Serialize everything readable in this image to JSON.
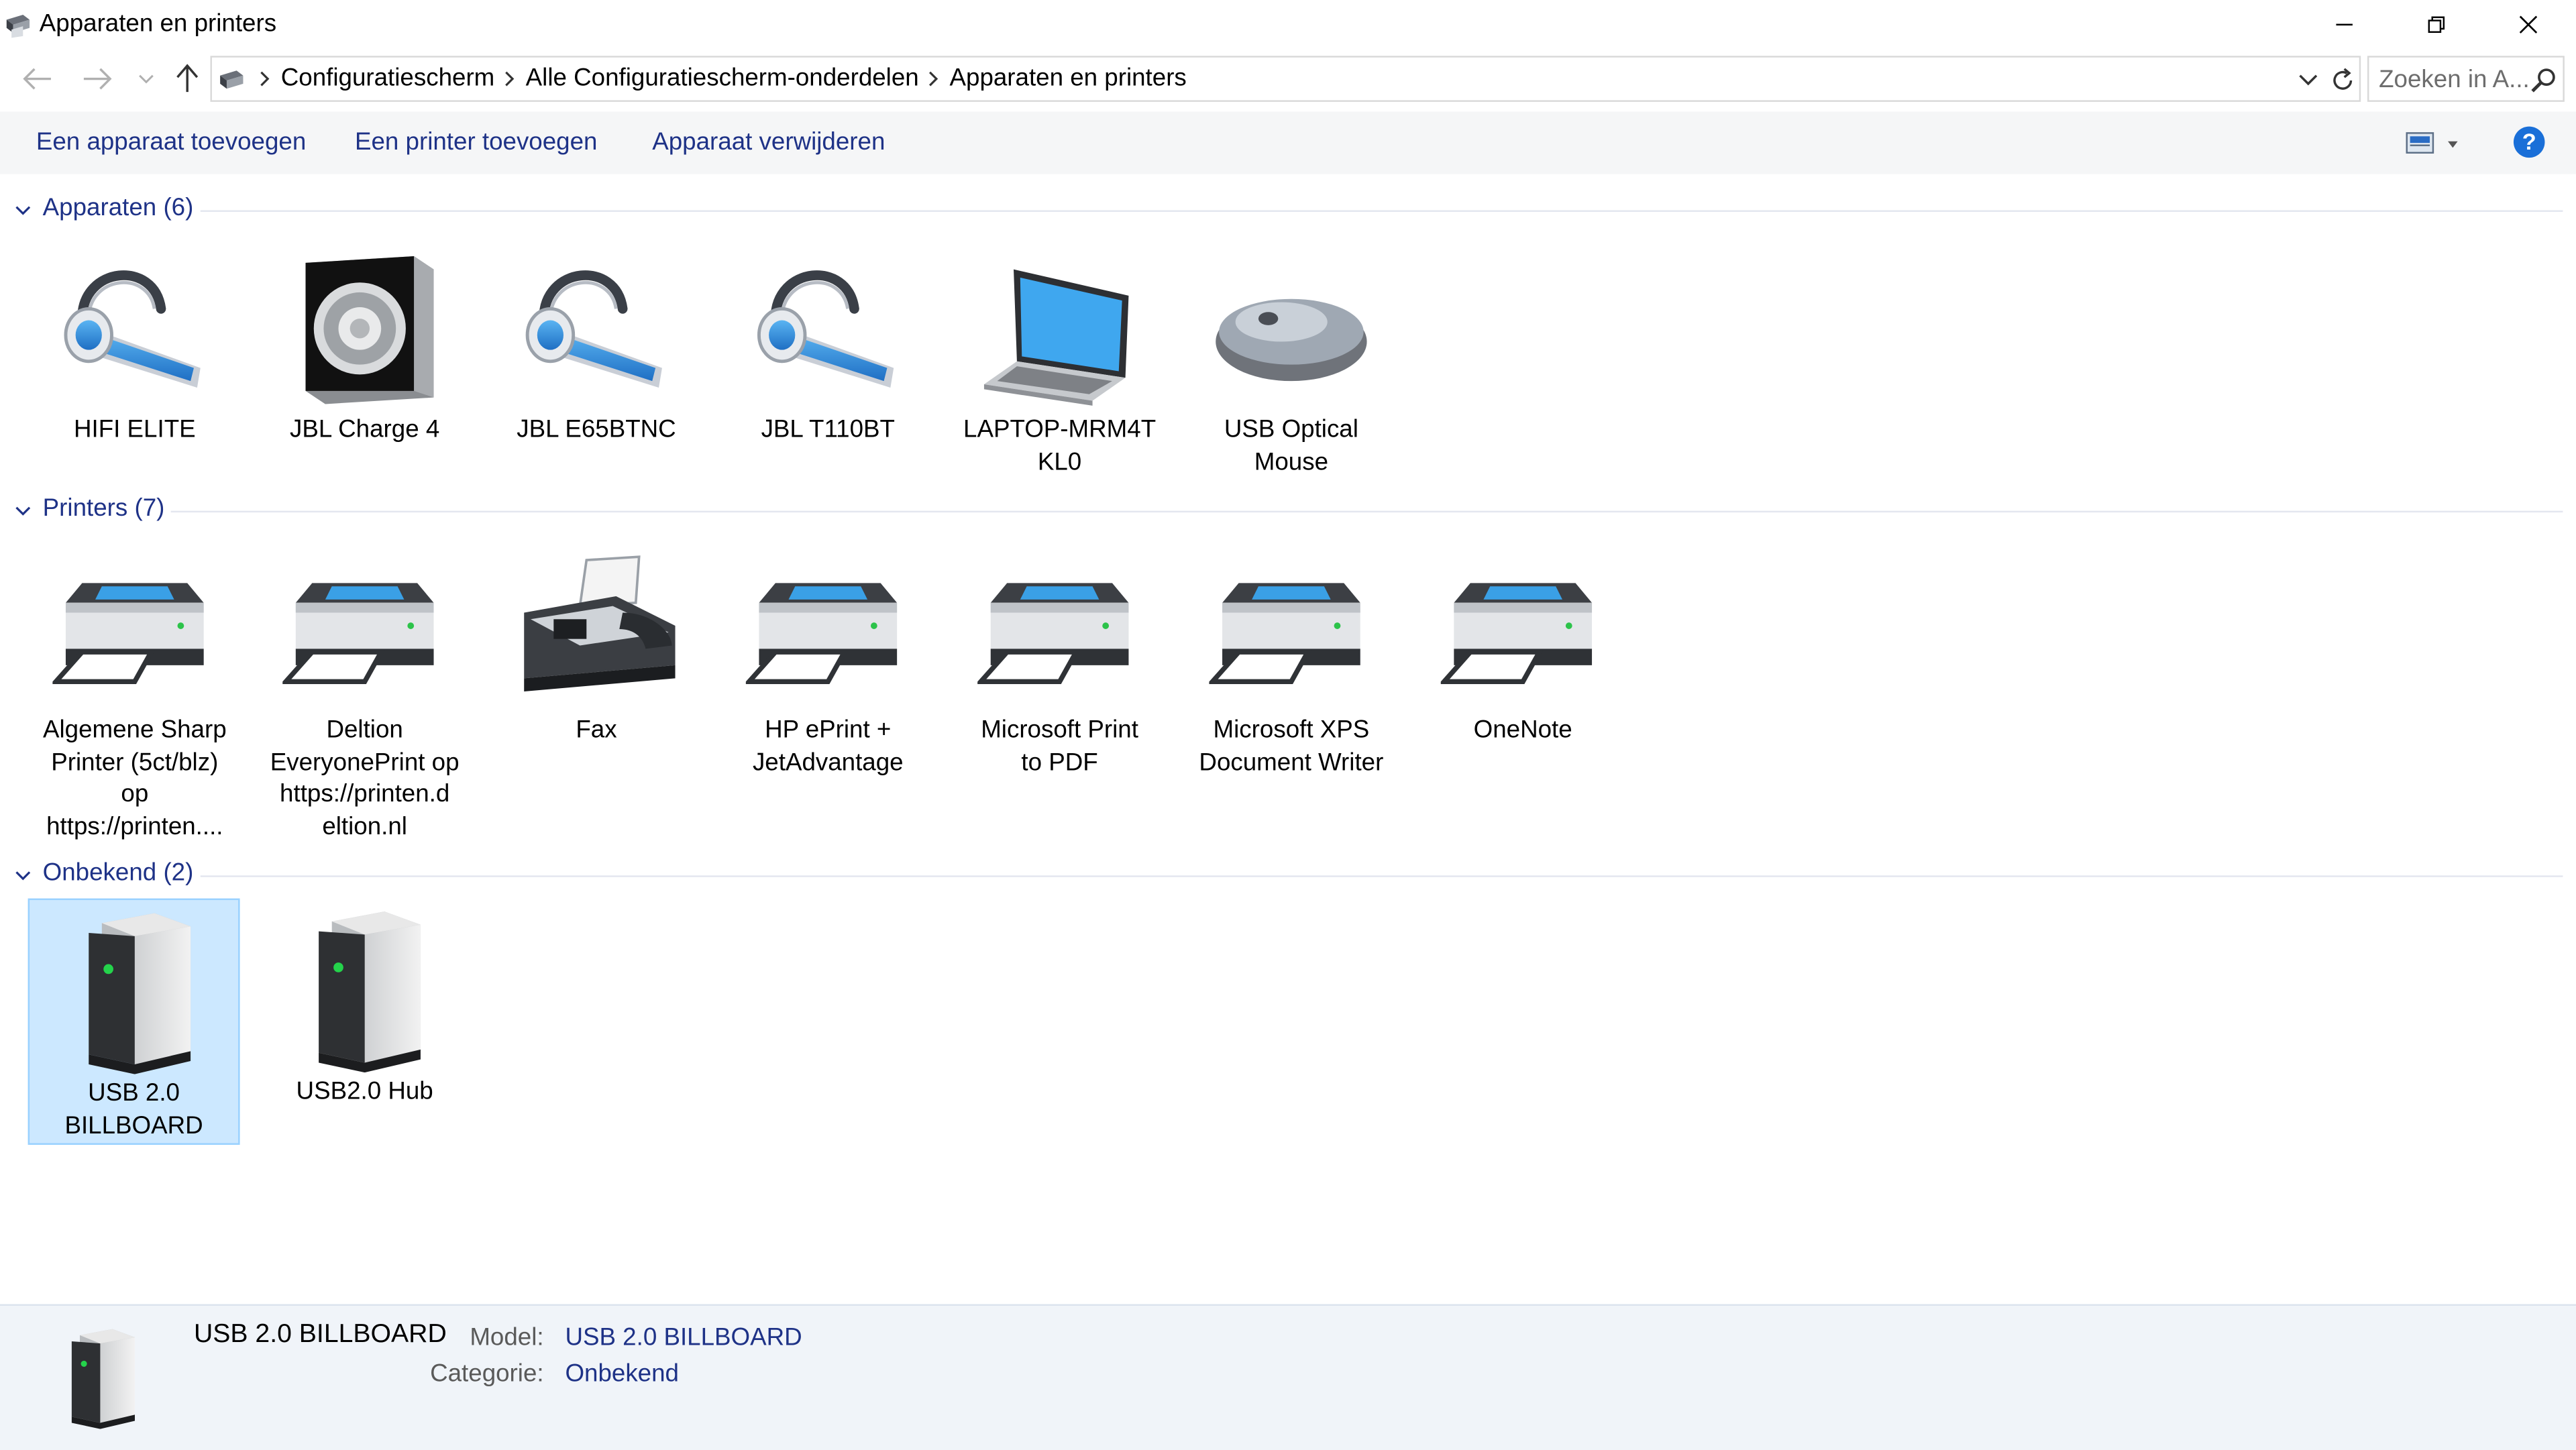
{
  "window": {
    "title": "Apparaten en printers"
  },
  "address": {
    "crumbs": [
      "Configuratiescherm",
      "Alle Configuratiescherm-onderdelen",
      "Apparaten en printers"
    ]
  },
  "search": {
    "placeholder": "Zoeken in A..."
  },
  "toolbar": {
    "add_device": "Een apparaat toevoegen",
    "add_printer": "Een printer toevoegen",
    "remove_device": "Apparaat verwijderen",
    "help": "?"
  },
  "groups": {
    "devices": {
      "label": "Apparaten",
      "count": "(6)",
      "items": [
        {
          "l1": "HIFI ELITE",
          "l2": "",
          "icon": "headset-icon"
        },
        {
          "l1": "JBL Charge 4",
          "l2": "",
          "icon": "speaker-icon"
        },
        {
          "l1": "JBL E65BTNC",
          "l2": "",
          "icon": "headset-icon"
        },
        {
          "l1": "JBL T110BT",
          "l2": "",
          "icon": "headset-icon"
        },
        {
          "l1": "LAPTOP-MRM4T",
          "l2": "KL0",
          "icon": "laptop-icon"
        },
        {
          "l1": "USB Optical",
          "l2": "Mouse",
          "icon": "mouse-icon"
        }
      ]
    },
    "printers": {
      "label": "Printers",
      "count": "(7)",
      "items": [
        {
          "l1": "Algemene Sharp",
          "l2": "Printer (5ct/blz)",
          "l3": "op",
          "l4": "https://printen....",
          "icon": "printer-icon"
        },
        {
          "l1": "Deltion",
          "l2": "EveryonePrint op",
          "l3": "https://printen.d",
          "l4": "eltion.nl",
          "icon": "printer-icon"
        },
        {
          "l1": "Fax",
          "l2": "",
          "icon": "fax-icon"
        },
        {
          "l1": "HP ePrint +",
          "l2": "JetAdvantage",
          "icon": "printer-icon"
        },
        {
          "l1": "Microsoft Print",
          "l2": "to PDF",
          "icon": "printer-icon"
        },
        {
          "l1": "Microsoft XPS",
          "l2": "Document Writer",
          "icon": "printer-icon"
        },
        {
          "l1": "OneNote",
          "l2": "",
          "icon": "printer-icon"
        }
      ]
    },
    "unknown": {
      "label": "Onbekend",
      "count": "(2)",
      "items": [
        {
          "l1": "USB 2.0",
          "l2": "BILLBOARD",
          "icon": "usb-box-icon",
          "selected": true
        },
        {
          "l1": "USB2.0 Hub",
          "l2": "",
          "icon": "usb-box-icon"
        }
      ]
    }
  },
  "details": {
    "name": "USB 2.0 BILLBOARD",
    "model_label": "Model:",
    "model_value": "USB 2.0 BILLBOARD",
    "category_label": "Categorie:",
    "category_value": "Onbekend"
  },
  "colors": {
    "link_blue": "#1e3287",
    "selection": "#cce8ff",
    "help_blue": "#1a6fd8"
  }
}
